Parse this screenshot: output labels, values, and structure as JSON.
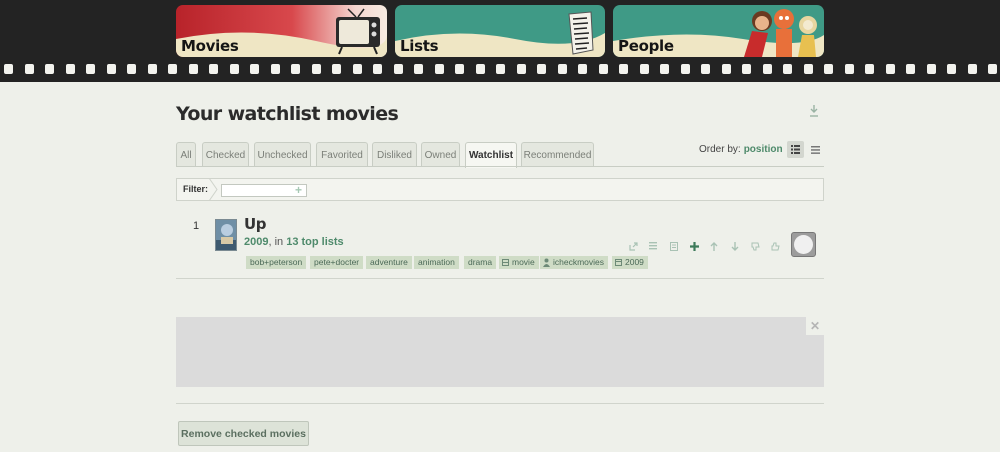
{
  "nav": {
    "movies_label": "Movies",
    "lists_label": "Lists",
    "people_label": "People"
  },
  "page": {
    "title": "Your watchlist movies"
  },
  "tabs": [
    {
      "label": "All"
    },
    {
      "label": "Checked"
    },
    {
      "label": "Unchecked"
    },
    {
      "label": "Favorited"
    },
    {
      "label": "Disliked"
    },
    {
      "label": "Owned"
    },
    {
      "label": "Watchlist"
    },
    {
      "label": "Recommended"
    }
  ],
  "active_tab": "Watchlist",
  "order": {
    "label": "Order by:",
    "value": "position"
  },
  "filter": {
    "label": "Filter:",
    "value": ""
  },
  "movie": {
    "rank": "1",
    "title": "Up",
    "year": "2009",
    "in_text": ", in ",
    "lists_link": "13 top lists",
    "tags": [
      "bob+peterson",
      "pete+docter",
      "adventure",
      "animation",
      "drama",
      "movie",
      "icheckmovies",
      "2009"
    ]
  },
  "actions": {
    "remove_checked": "Remove checked movies"
  },
  "colors": {
    "header_bg": "#232323",
    "accent_green": "#4e8a6b",
    "tag_bg": "#cfdcc6",
    "movies_red": "#c0282d",
    "lists_teal": "#3f9a86",
    "people_teal": "#3f9a86",
    "cream": "#efe6c4"
  }
}
